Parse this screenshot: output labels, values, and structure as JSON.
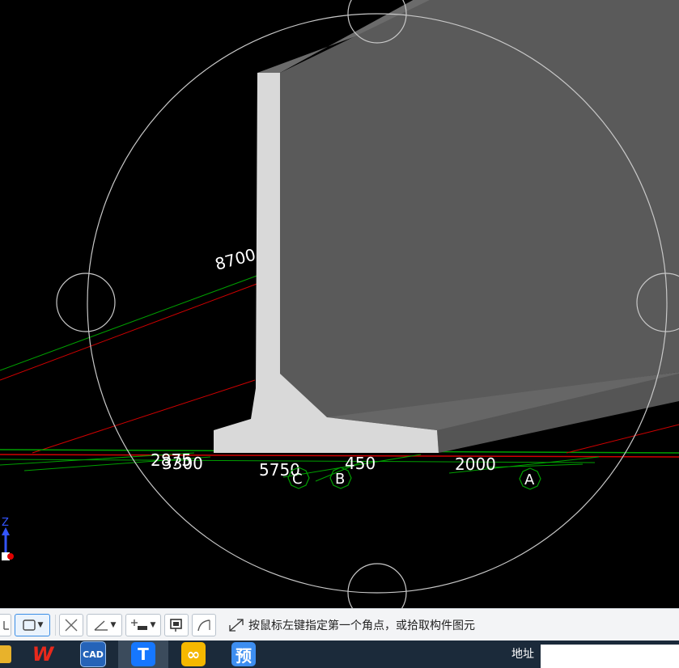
{
  "viewport": {
    "dimensions": {
      "d8700": "8700",
      "d2875": "2875",
      "d3300": "3300",
      "d5750": "5750",
      "d450": "450",
      "d2000": "2000"
    },
    "grid_axes": [
      {
        "label": "C"
      },
      {
        "label": "B"
      },
      {
        "label": "A"
      }
    ],
    "ucs_z_label": "Z",
    "colors": {
      "wall_front": "#d9d9d9",
      "wall_top": "#6b6b6b",
      "wall_side": "#5c5c5c",
      "grid_green": "#00a000",
      "grid_red": "#d00000",
      "circle": "#c8c8c8"
    }
  },
  "toolbar": {
    "tools": [
      {
        "icon": "line-select-icon"
      },
      {
        "icon": "rect-select-icon"
      },
      {
        "icon": "cross-select-icon"
      },
      {
        "icon": "angle-icon"
      },
      {
        "icon": "offset-icon"
      },
      {
        "icon": "screen-icon"
      },
      {
        "icon": "arc-icon"
      }
    ],
    "prompt_icon": "expand-icon",
    "prompt": "按鼠标左键指定第一个角点，或拾取构件图元"
  },
  "taskbar": {
    "apps": [
      {
        "name": "file-explorer",
        "label": ""
      },
      {
        "name": "wps",
        "label": "W"
      },
      {
        "name": "cad",
        "label": "CAD"
      },
      {
        "name": "glodon",
        "label": "T"
      },
      {
        "name": "yellow-app",
        "label": "∞"
      },
      {
        "name": "budget-app",
        "label": "预"
      }
    ],
    "address_label": "地址"
  }
}
